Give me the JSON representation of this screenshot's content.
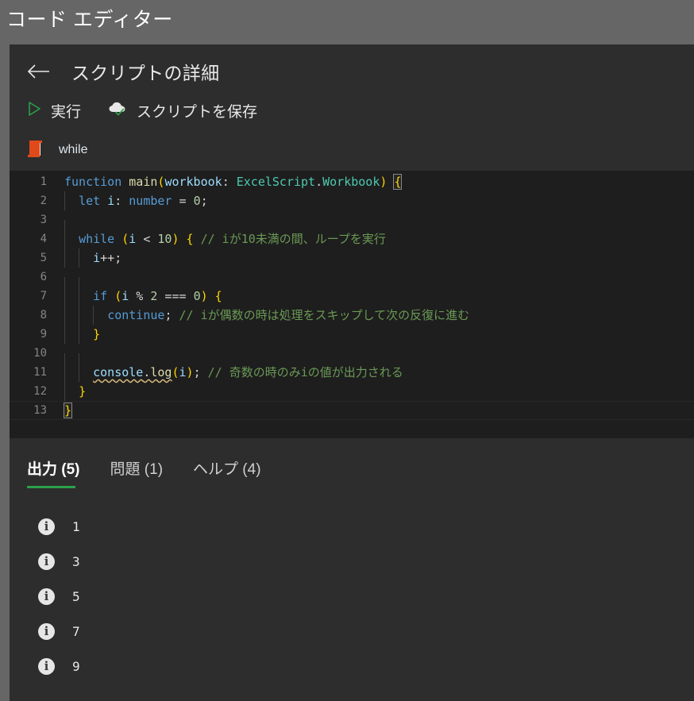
{
  "app": {
    "title": "コード エディター"
  },
  "script_detail": {
    "back_icon": "back-arrow-icon",
    "heading": "スクリプトの詳細",
    "commands": [
      {
        "id": "run",
        "icon": "play-triangle-icon",
        "label": "実行"
      },
      {
        "id": "save",
        "icon": "cloud-save-icon",
        "label": "スクリプトを保存"
      }
    ],
    "script_icon": "script-scroll-icon",
    "script_name": "while"
  },
  "editor": {
    "lines": [
      {
        "n": "1",
        "tokens": [
          {
            "t": "function",
            "c": "kw"
          },
          {
            "t": " ",
            "c": "pl"
          },
          {
            "t": "main",
            "c": "fn"
          },
          {
            "t": "(",
            "c": "par1"
          },
          {
            "t": "workbook",
            "c": "var"
          },
          {
            "t": ": ",
            "c": "pl"
          },
          {
            "t": "ExcelScript",
            "c": "type"
          },
          {
            "t": ".",
            "c": "pl"
          },
          {
            "t": "Workbook",
            "c": "type"
          },
          {
            "t": ")",
            "c": "par1"
          },
          {
            "t": " ",
            "c": "pl"
          },
          {
            "t": "{",
            "c": "par1 brkt-hl"
          }
        ]
      },
      {
        "n": "2",
        "indent": 1,
        "tokens": [
          {
            "t": "  ",
            "c": "pl"
          },
          {
            "t": "let",
            "c": "kw"
          },
          {
            "t": " ",
            "c": "pl"
          },
          {
            "t": "i",
            "c": "var"
          },
          {
            "t": ": ",
            "c": "pl"
          },
          {
            "t": "number",
            "c": "kw"
          },
          {
            "t": " = ",
            "c": "pl"
          },
          {
            "t": "0",
            "c": "num"
          },
          {
            "t": ";",
            "c": "pl"
          }
        ]
      },
      {
        "n": "3",
        "indent": 1,
        "tokens": []
      },
      {
        "n": "4",
        "indent": 1,
        "tokens": [
          {
            "t": "  ",
            "c": "pl"
          },
          {
            "t": "while",
            "c": "kw"
          },
          {
            "t": " ",
            "c": "pl"
          },
          {
            "t": "(",
            "c": "par1"
          },
          {
            "t": "i",
            "c": "var"
          },
          {
            "t": " < ",
            "c": "pl"
          },
          {
            "t": "10",
            "c": "num"
          },
          {
            "t": ")",
            "c": "par1"
          },
          {
            "t": " ",
            "c": "pl"
          },
          {
            "t": "{",
            "c": "par1"
          },
          {
            "t": " ",
            "c": "pl"
          },
          {
            "t": "// iが10未満の間、ループを実行",
            "c": "cmt"
          }
        ]
      },
      {
        "n": "5",
        "indent": 2,
        "tokens": [
          {
            "t": "    ",
            "c": "pl"
          },
          {
            "t": "i",
            "c": "var"
          },
          {
            "t": "++;",
            "c": "pl"
          }
        ]
      },
      {
        "n": "6",
        "indent": 2,
        "tokens": []
      },
      {
        "n": "7",
        "indent": 2,
        "tokens": [
          {
            "t": "    ",
            "c": "pl"
          },
          {
            "t": "if",
            "c": "kw"
          },
          {
            "t": " ",
            "c": "pl"
          },
          {
            "t": "(",
            "c": "par1"
          },
          {
            "t": "i",
            "c": "var"
          },
          {
            "t": " % ",
            "c": "pl"
          },
          {
            "t": "2",
            "c": "num"
          },
          {
            "t": " === ",
            "c": "pl"
          },
          {
            "t": "0",
            "c": "num"
          },
          {
            "t": ")",
            "c": "par1"
          },
          {
            "t": " ",
            "c": "pl"
          },
          {
            "t": "{",
            "c": "par1"
          }
        ]
      },
      {
        "n": "8",
        "indent": 3,
        "tokens": [
          {
            "t": "      ",
            "c": "pl"
          },
          {
            "t": "continue",
            "c": "kw"
          },
          {
            "t": ";",
            "c": "pl"
          },
          {
            "t": " ",
            "c": "pl"
          },
          {
            "t": "// iが偶数の時は処理をスキップして次の反復に進む",
            "c": "cmt"
          }
        ]
      },
      {
        "n": "9",
        "indent": 2,
        "tokens": [
          {
            "t": "    ",
            "c": "pl"
          },
          {
            "t": "}",
            "c": "par1"
          }
        ]
      },
      {
        "n": "10",
        "indent": 2,
        "tokens": []
      },
      {
        "n": "11",
        "indent": 2,
        "tokens": [
          {
            "t": "    ",
            "c": "pl"
          },
          {
            "t": "console",
            "c": "var squiggle"
          },
          {
            "t": ".",
            "c": "pl squiggle"
          },
          {
            "t": "log",
            "c": "fn squiggle"
          },
          {
            "t": "(",
            "c": "par1"
          },
          {
            "t": "i",
            "c": "var"
          },
          {
            "t": ")",
            "c": "par1"
          },
          {
            "t": ";",
            "c": "pl"
          },
          {
            "t": " ",
            "c": "pl"
          },
          {
            "t": "// 奇数の時のみiの値が出力される",
            "c": "cmt"
          }
        ]
      },
      {
        "n": "12",
        "indent": 1,
        "tokens": [
          {
            "t": "  ",
            "c": "pl"
          },
          {
            "t": "}",
            "c": "par1"
          }
        ]
      },
      {
        "n": "13",
        "current": true,
        "tokens": [
          {
            "t": "}",
            "c": "par1 brkt-hl"
          }
        ]
      }
    ]
  },
  "output": {
    "tabs": [
      {
        "label": "出力 (5)",
        "active": true
      },
      {
        "label": "問題 (1)",
        "active": false
      },
      {
        "label": "ヘルプ (4)",
        "active": false
      }
    ],
    "rows": [
      {
        "icon": "info-icon",
        "text": "1"
      },
      {
        "icon": "info-icon",
        "text": "3"
      },
      {
        "icon": "info-icon",
        "text": "5"
      },
      {
        "icon": "info-icon",
        "text": "7"
      },
      {
        "icon": "info-icon",
        "text": "9"
      }
    ]
  },
  "colors": {
    "page_bg": "#666666",
    "panel_bg": "#2d2d2d",
    "editor_bg": "#1e1e1e",
    "accent_green": "#2aa04a",
    "script_icon": "#e04a1b"
  }
}
